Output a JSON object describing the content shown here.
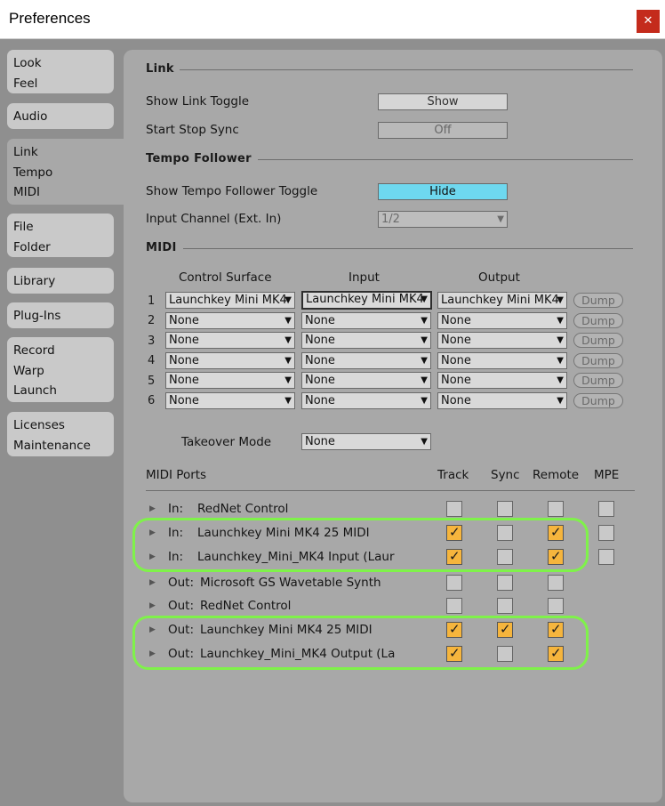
{
  "window": {
    "title": "Preferences",
    "close_icon": "✕"
  },
  "sidebar": {
    "tabs": [
      {
        "lines": [
          "Look",
          "Feel"
        ]
      },
      {
        "lines": [
          "Audio"
        ]
      },
      {
        "lines": [
          "Link",
          "Tempo",
          "MIDI"
        ],
        "active": true
      },
      {
        "lines": [
          "File",
          "Folder"
        ]
      },
      {
        "lines": [
          "Library"
        ]
      },
      {
        "lines": [
          "Plug-Ins"
        ]
      },
      {
        "lines": [
          "Record",
          "Warp",
          "Launch"
        ]
      },
      {
        "lines": [
          "Licenses",
          "Maintenance"
        ]
      }
    ]
  },
  "link": {
    "header": "Link",
    "show_link_toggle_label": "Show Link Toggle",
    "show_link_toggle_value": "Show",
    "start_stop_sync_label": "Start Stop Sync",
    "start_stop_sync_value": "Off"
  },
  "tempo": {
    "header": "Tempo Follower",
    "toggle_label": "Show Tempo Follower Toggle",
    "toggle_value": "Hide",
    "input_channel_label": "Input Channel (Ext. In)",
    "input_channel_value": "1/2"
  },
  "midi": {
    "header": "MIDI",
    "col_control_surface": "Control Surface",
    "col_input": "Input",
    "col_output": "Output",
    "dump_label": "Dump",
    "rows": [
      {
        "num": "1",
        "surface": "Launchkey Mini MK4",
        "input": "Launchkey Mini MK4",
        "output": "Launchkey Mini MK4"
      },
      {
        "num": "2",
        "surface": "None",
        "input": "None",
        "output": "None"
      },
      {
        "num": "3",
        "surface": "None",
        "input": "None",
        "output": "None"
      },
      {
        "num": "4",
        "surface": "None",
        "input": "None",
        "output": "None"
      },
      {
        "num": "5",
        "surface": "None",
        "input": "None",
        "output": "None"
      },
      {
        "num": "6",
        "surface": "None",
        "input": "None",
        "output": "None"
      }
    ],
    "takeover_label": "Takeover Mode",
    "takeover_value": "None"
  },
  "ports": {
    "header": "MIDI Ports",
    "col_track": "Track",
    "col_sync": "Sync",
    "col_remote": "Remote",
    "col_mpe": "MPE",
    "rows": [
      {
        "dir": "In:",
        "name": "RedNet Control",
        "track": false,
        "sync": false,
        "remote": false,
        "mpe": false
      },
      {
        "dir": "In:",
        "name": "Launchkey Mini MK4 25 MIDI",
        "track": true,
        "sync": false,
        "remote": true,
        "mpe": false
      },
      {
        "dir": "In:",
        "name": "Launchkey_Mini_MK4 Input (Laur",
        "track": true,
        "sync": false,
        "remote": true,
        "mpe": false
      },
      {
        "dir": "Out:",
        "name": "Microsoft GS Wavetable Synth",
        "track": false,
        "sync": false,
        "remote": false
      },
      {
        "dir": "Out:",
        "name": "RedNet Control",
        "track": false,
        "sync": false,
        "remote": false
      },
      {
        "dir": "Out:",
        "name": "Launchkey Mini MK4 25 MIDI",
        "track": true,
        "sync": true,
        "remote": true
      },
      {
        "dir": "Out:",
        "name": "Launchkey_Mini_MK4 Output (La",
        "track": true,
        "sync": false,
        "remote": true
      }
    ]
  },
  "colors": {
    "highlight": "#7ff24a",
    "checkbox_on": "#f6b53d",
    "hide_button": "#6ed8ef",
    "close_button": "#c42b1c"
  }
}
